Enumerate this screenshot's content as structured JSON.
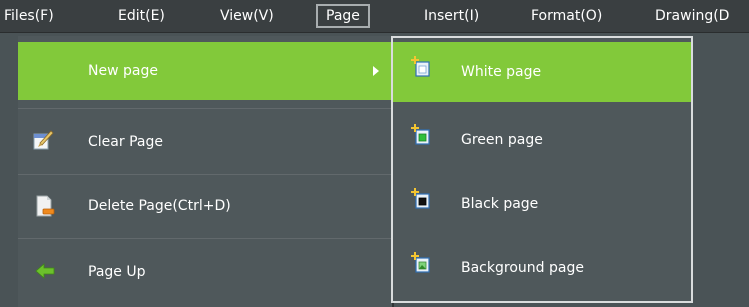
{
  "menubar": {
    "files": "Files(F)",
    "edit": "Edit(E)",
    "view": "View(V)",
    "page": "Page",
    "insert": "Insert(I)",
    "format": "Format(O)",
    "drawing": "Drawing(D"
  },
  "page_menu": {
    "new_page": "New page",
    "clear_page": "Clear Page",
    "delete_page": "Delete Page(Ctrl+D)",
    "page_up": "Page Up"
  },
  "new_page_submenu": {
    "white_page": "White page",
    "green_page": "Green page",
    "black_page": "Black page",
    "background_page": "Background page"
  },
  "colors": {
    "highlight": "#82c93a",
    "menu_bg": "#4f585b",
    "menubar_bg": "#3a3f41"
  }
}
